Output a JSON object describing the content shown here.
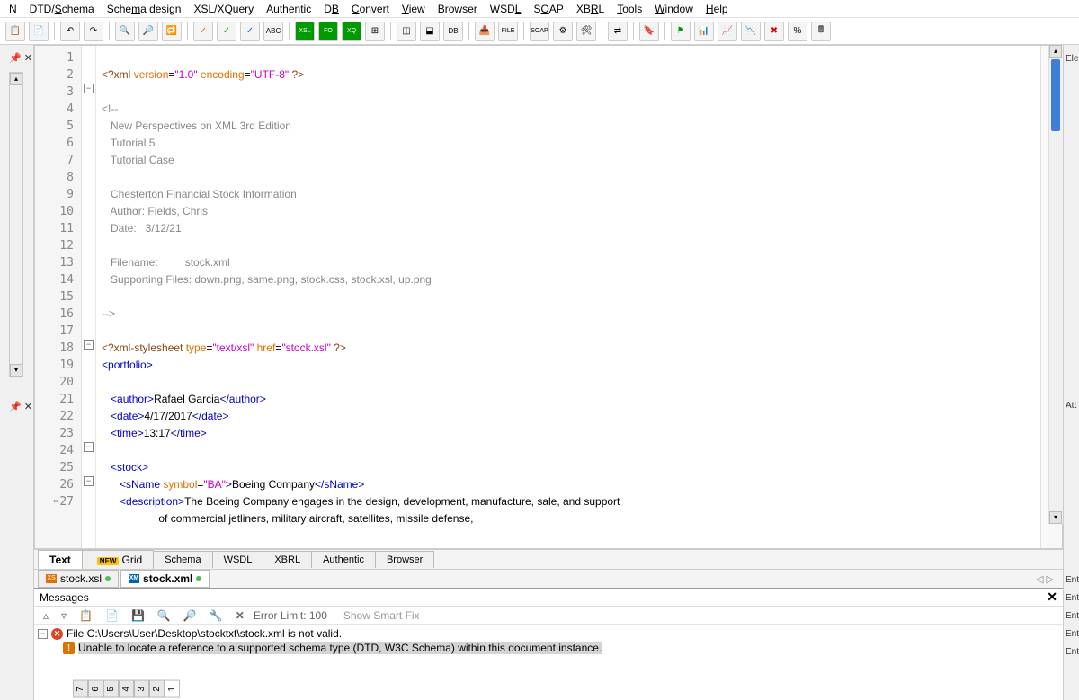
{
  "menu": [
    "N",
    "DTD/Schema",
    "Schema design",
    "XSL/XQuery",
    "Authentic",
    "DB",
    "Convert",
    "View",
    "Browser",
    "WSDL",
    "SOAP",
    "XBRL",
    "Tools",
    "Window",
    "Help"
  ],
  "menu_u": [
    "",
    "S",
    "",
    "",
    "",
    "B",
    "C",
    "V",
    "",
    "L",
    "O",
    "",
    "T",
    "W",
    "H"
  ],
  "code": {
    "l1a": "<?xml ",
    "l1b": "version",
    "l1c": "=",
    "l1d": "\"1.0\"",
    "l1e": " encoding",
    "l1f": "=",
    "l1g": "\"UTF-8\"",
    "l1h": " ?>",
    "l3": "<!--",
    "l4": "   New Perspectives on XML 3rd Edition",
    "l5": "   Tutorial 5",
    "l6": "   Tutorial Case",
    "l8": "   Chesterton Financial Stock Information",
    "l9": "   Author: Fields, Chris",
    "l10": "   Date:   3/12/21",
    "l12": "   Filename:         stock.xml",
    "l13": "   Supporting Files: down.png, same.png, stock.css, stock.xsl, up.png",
    "l15": "-->",
    "l17a": "<?xml-stylesheet ",
    "l17b": "type",
    "l17c": "=",
    "l17d": "\"text/xsl\"",
    "l17e": " href",
    "l17f": "=",
    "l17g": "\"stock.xsl\"",
    "l17h": " ?>",
    "l18a": "<",
    "l18b": "portfolio",
    "l18c": ">",
    "l20a": "   <",
    "l20b": "author",
    "l20c": ">",
    "l20d": "Rafael Garcia",
    "l20e": "</",
    "l20f": "author",
    "l20g": ">",
    "l21a": "   <",
    "l21b": "date",
    "l21c": ">",
    "l21d": "4/17/2017",
    "l21e": "</",
    "l21f": "date",
    "l21g": ">",
    "l22a": "   <",
    "l22b": "time",
    "l22c": ">",
    "l22d": "13:17",
    "l22e": "</",
    "l22f": "time",
    "l22g": ">",
    "l24a": "   <",
    "l24b": "stock",
    "l24c": ">",
    "l25a": "      <",
    "l25b": "sName",
    "l25c": " symbol",
    "l25d": "=",
    "l25e": "\"BA\"",
    "l25f": ">",
    "l25g": "Boeing Company",
    "l25h": "</",
    "l25i": "sName",
    "l25j": ">",
    "l26a": "      <",
    "l26b": "description",
    "l26c": ">",
    "l26d": "The Boeing Company engages in the design, development, manufacture, sale, and support",
    "l27": "                   of commercial jetliners, military aircraft, satellites, missile defense,"
  },
  "viewtabs": {
    "text": "Text",
    "grid": "Grid",
    "schema": "Schema",
    "wsdl": "WSDL",
    "xbrl": "XBRL",
    "auth": "Authentic",
    "browser": "Browser",
    "new": "NEW"
  },
  "filetabs": {
    "xsl": "stock.xsl",
    "xml": "stock.xml"
  },
  "messages": {
    "title": "Messages",
    "errlimit": "Error Limit: 100",
    "smartfix": "Show Smart Fix",
    "l1": "File C:\\Users\\User\\Desktop\\stocktxt\\stock.xml is not valid.",
    "l2": "Unable to locate a reference to a supported schema type (DTD, W3C Schema) within this document instance."
  },
  "rightdock": {
    "ele": "Ele",
    "att": "Att",
    "ent": "Ent"
  },
  "msgtabs": [
    "1",
    "2",
    "3",
    "4",
    "5",
    "6",
    "7"
  ]
}
